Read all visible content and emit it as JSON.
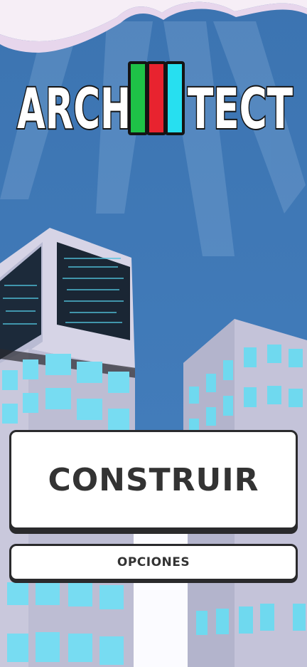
{
  "logo": {
    "text_left": "ARCH",
    "text_right": "TECT",
    "bar_colors": [
      "#1ec247",
      "#e8232f",
      "#27dff0"
    ]
  },
  "menu": {
    "build_label": "CONSTRUIR",
    "options_label": "OPCIONES"
  }
}
